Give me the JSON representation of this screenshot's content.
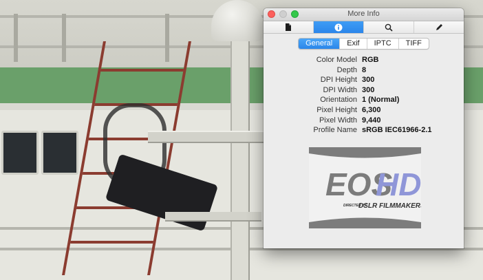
{
  "window": {
    "title": "More Info",
    "toolbar_tabs": [
      {
        "icon": "document-icon"
      },
      {
        "icon": "info-icon",
        "active": true
      },
      {
        "icon": "magnifier-icon"
      },
      {
        "icon": "pencil-icon"
      }
    ],
    "segments": [
      {
        "label": "General",
        "active": true
      },
      {
        "label": "Exif"
      },
      {
        "label": "IPTC"
      },
      {
        "label": "TIFF"
      }
    ],
    "properties": [
      {
        "label": "Color Model",
        "value": "RGB"
      },
      {
        "label": "Depth",
        "value": "8"
      },
      {
        "label": "DPI Height",
        "value": "300"
      },
      {
        "label": "DPI Width",
        "value": "300"
      },
      {
        "label": "Orientation",
        "value": "1 (Normal)"
      },
      {
        "label": "Pixel Height",
        "value": "6,300"
      },
      {
        "label": "Pixel Width",
        "value": "9,440"
      },
      {
        "label": "Profile Name",
        "value": "sRGB IEC61966-2.1"
      }
    ],
    "logo": {
      "part1": "EOS",
      "part2": "HD",
      "tagline1": "DIRECTED BY",
      "tagline2": "DSLR FILMMAKERS"
    }
  },
  "colors": {
    "accent": "#2b86ea",
    "close": "#fc605c",
    "zoom": "#34c84a",
    "logo_gray": "#7c7c7c",
    "logo_blue": "#8f96d8"
  }
}
